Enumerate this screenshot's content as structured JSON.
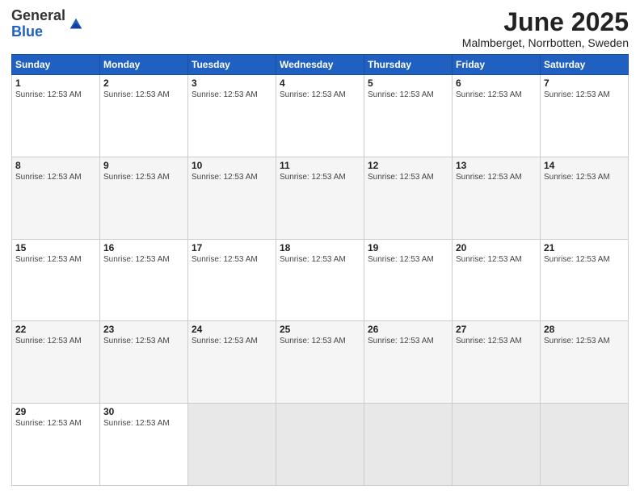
{
  "logo": {
    "general": "General",
    "blue": "Blue"
  },
  "title": "June 2025",
  "subtitle": "Malmberget, Norrbotten, Sweden",
  "header": {
    "days": [
      "Sunday",
      "Monday",
      "Tuesday",
      "Wednesday",
      "Thursday",
      "Friday",
      "Saturday"
    ]
  },
  "sunrise_text": "Sunrise: 12:53 AM",
  "weeks": [
    [
      {
        "day": "1",
        "info": "Sunrise: 12:53 AM"
      },
      {
        "day": "2",
        "info": "Sunrise: 12:53 AM"
      },
      {
        "day": "3",
        "info": "Sunrise: 12:53 AM"
      },
      {
        "day": "4",
        "info": "Sunrise: 12:53 AM"
      },
      {
        "day": "5",
        "info": "Sunrise: 12:53 AM"
      },
      {
        "day": "6",
        "info": "Sunrise: 12:53 AM"
      },
      {
        "day": "7",
        "info": "Sunrise: 12:53 AM"
      }
    ],
    [
      {
        "day": "8",
        "info": "Sunrise: 12:53 AM"
      },
      {
        "day": "9",
        "info": "Sunrise: 12:53 AM"
      },
      {
        "day": "10",
        "info": "Sunrise: 12:53 AM"
      },
      {
        "day": "11",
        "info": "Sunrise: 12:53 AM"
      },
      {
        "day": "12",
        "info": "Sunrise: 12:53 AM"
      },
      {
        "day": "13",
        "info": "Sunrise: 12:53 AM"
      },
      {
        "day": "14",
        "info": "Sunrise: 12:53 AM"
      }
    ],
    [
      {
        "day": "15",
        "info": "Sunrise: 12:53 AM"
      },
      {
        "day": "16",
        "info": "Sunrise: 12:53 AM"
      },
      {
        "day": "17",
        "info": "Sunrise: 12:53 AM"
      },
      {
        "day": "18",
        "info": "Sunrise: 12:53 AM"
      },
      {
        "day": "19",
        "info": "Sunrise: 12:53 AM"
      },
      {
        "day": "20",
        "info": "Sunrise: 12:53 AM"
      },
      {
        "day": "21",
        "info": "Sunrise: 12:53 AM"
      }
    ],
    [
      {
        "day": "22",
        "info": "Sunrise: 12:53 AM"
      },
      {
        "day": "23",
        "info": "Sunrise: 12:53 AM"
      },
      {
        "day": "24",
        "info": "Sunrise: 12:53 AM"
      },
      {
        "day": "25",
        "info": "Sunrise: 12:53 AM"
      },
      {
        "day": "26",
        "info": "Sunrise: 12:53 AM"
      },
      {
        "day": "27",
        "info": "Sunrise: 12:53 AM"
      },
      {
        "day": "28",
        "info": "Sunrise: 12:53 AM"
      }
    ],
    [
      {
        "day": "29",
        "info": "Sunrise: 12:53 AM"
      },
      {
        "day": "30",
        "info": "Sunrise: 12:53 AM"
      },
      null,
      null,
      null,
      null,
      null
    ]
  ]
}
